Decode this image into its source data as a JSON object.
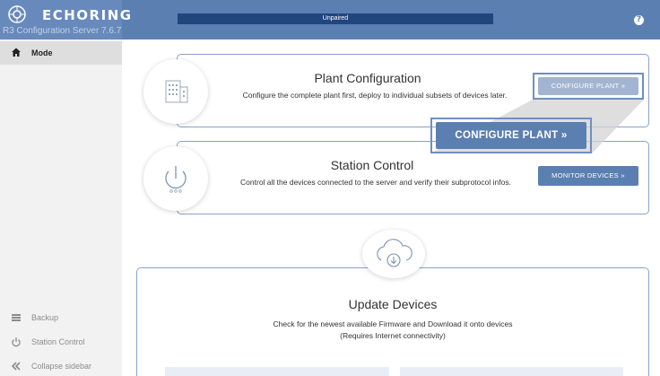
{
  "brand": {
    "name": "ECHORING",
    "subtitle": "R3 Configuration Server 7.6.7",
    "logo_icon": "echoring-logo-icon"
  },
  "header": {
    "status": "Unpaired",
    "help_icon": "?"
  },
  "sidebar": {
    "items": [
      {
        "label": "Mode",
        "icon": "home-icon"
      },
      {
        "label": "Backup",
        "icon": "list-icon"
      },
      {
        "label": "Station Control",
        "icon": "power-icon"
      },
      {
        "label": "Collapse sidebar",
        "icon": "double-chevron-left-icon"
      }
    ]
  },
  "plant": {
    "title": "Plant Configuration",
    "description": "Configure the complete plant first, deploy to individual subsets of devices later.",
    "button": "CONFIGURE PLANT »",
    "button_zoomed": "CONFIGURE PLANT »",
    "icon": "building-icon"
  },
  "station": {
    "title": "Station Control",
    "description": "Control all the devices connected to the server and verify their subprotocol infos.",
    "button": "MONITOR DEVICES »",
    "icon": "power-icon"
  },
  "update": {
    "title": "Update Devices",
    "description_line1": "Check for the newest available Firmware and Download it onto devices",
    "description_line2": "(Requires Internet connectivity)",
    "icon": "cloud-download-icon"
  },
  "colors": {
    "header": "#5b7fb1",
    "status_bar": "#21467e",
    "button": "#5b7fb1",
    "button_disabled": "#a2b4d1",
    "card_border": "#8aa3c6"
  }
}
